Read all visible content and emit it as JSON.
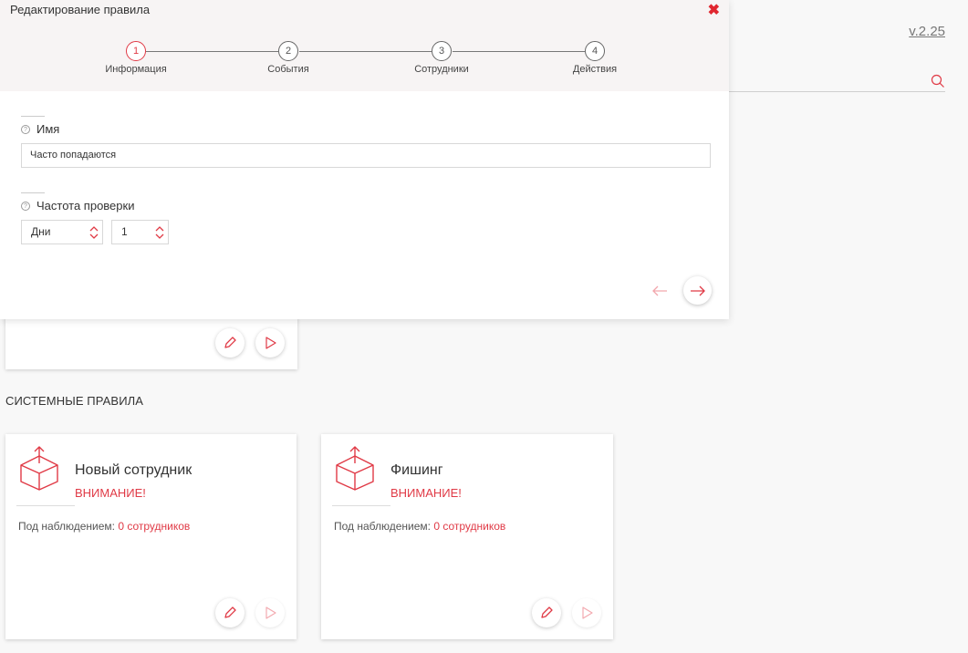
{
  "version": "v.2.25",
  "section_title": "СИСТЕМНЫЕ ПРАВИЛА",
  "modal": {
    "title": "Редактирование правила",
    "close": "✖",
    "steps": [
      {
        "number": "1",
        "label": "Информация",
        "active": true
      },
      {
        "number": "2",
        "label": "События",
        "active": false
      },
      {
        "number": "3",
        "label": "Сотрудники",
        "active": false
      },
      {
        "number": "4",
        "label": "Действия",
        "active": false
      }
    ],
    "name_label": "Имя",
    "name_value": "Часто попадаются",
    "frequency_label": "Частота проверки",
    "frequency_unit": "Дни",
    "frequency_value": "1",
    "help_glyph": "?"
  },
  "rules": [
    {
      "title": "Новый сотрудник",
      "warning": "ВНИМАНИЕ!",
      "watch_label": "Под наблюдением: ",
      "watch_link": "0 сотрудников"
    },
    {
      "title": "Фишинг",
      "warning": "ВНИМАНИЕ!",
      "watch_label": "Под наблюдением: ",
      "watch_link": "0 сотрудников"
    }
  ],
  "colors": {
    "accent": "#e03a46",
    "background": "#f8f8f8"
  }
}
